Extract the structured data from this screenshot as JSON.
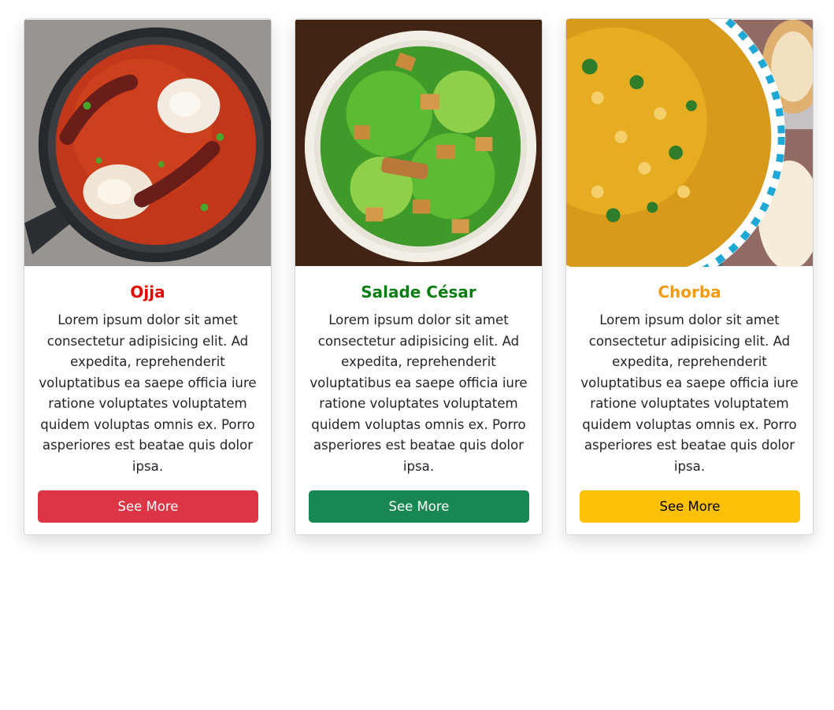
{
  "cards": [
    {
      "title": "Ojja",
      "title_color": "#e10600",
      "text": "Lorem ipsum dolor sit amet consectetur adipisicing elit. Ad expedita, reprehenderit voluptatibus ea saepe officia iure ratione voluptates voluptatem quidem voluptas omnis ex. Porro asperiores est beatae quis dolor ipsa.",
      "button_label": "See More",
      "button_color": "#dc3545",
      "button_text_color": "#ffffff",
      "image": "shakshuka-pan-photo"
    },
    {
      "title": "Salade César",
      "title_color": "#0a7d12",
      "text": "Lorem ipsum dolor sit amet consectetur adipisicing elit. Ad expedita, reprehenderit voluptatibus ea saepe officia iure ratione voluptates voluptatem quidem voluptas omnis ex. Porro asperiores est beatae quis dolor ipsa.",
      "button_label": "See More",
      "button_color": "#198754",
      "button_text_color": "#ffffff",
      "image": "caesar-salad-plate-photo"
    },
    {
      "title": "Chorba",
      "title_color": "#f39c12",
      "text": "Lorem ipsum dolor sit amet consectetur adipisicing elit. Ad expedita, reprehenderit voluptatibus ea saepe officia iure ratione voluptates voluptatem quidem voluptas omnis ex. Porro asperiores est beatae quis dolor ipsa.",
      "button_label": "See More",
      "button_color": "#ffc107",
      "button_text_color": "#000000",
      "image": "chorba-soup-bowl-photo"
    }
  ]
}
